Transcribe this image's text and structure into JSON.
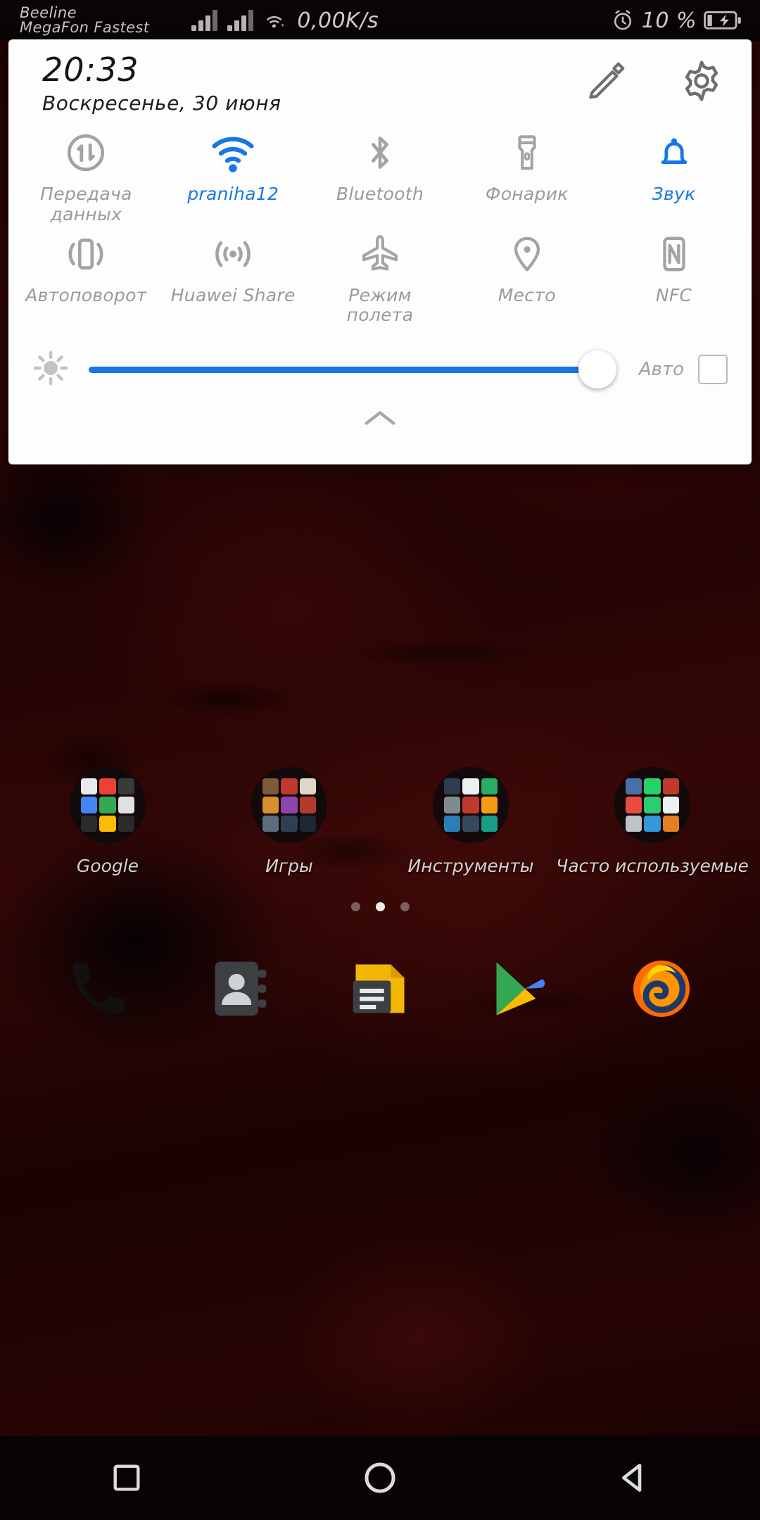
{
  "status_bar": {
    "carrier_line1": "Beeline",
    "carrier_line2": "MegaFon Fastest",
    "data_speed": "0,00K/s",
    "battery_percent": "10 %",
    "icons": [
      "signal-bars-icon",
      "signal-bars-icon",
      "wifi-icon",
      "alarm-clock-icon",
      "battery-charging-icon"
    ]
  },
  "quick_settings": {
    "time": "20:33",
    "date": "Воскресенье, 30 июня",
    "edit_icon": "pencil-icon",
    "settings_icon": "gear-icon",
    "accent_color": "#1678e8",
    "off_color": "#9a9a9a",
    "toggles": [
      {
        "label": "Передача данных",
        "icon": "mobile-data-icon",
        "state": "off"
      },
      {
        "label": "praniha12",
        "icon": "wifi-icon",
        "state": "on"
      },
      {
        "label": "Bluetooth",
        "icon": "bluetooth-icon",
        "state": "off"
      },
      {
        "label": "Фонарик",
        "icon": "flashlight-icon",
        "state": "off"
      },
      {
        "label": "Звук",
        "icon": "bell-icon",
        "state": "on"
      },
      {
        "label": "Автоповорот",
        "icon": "auto-rotate-icon",
        "state": "off"
      },
      {
        "label": "Huawei Share",
        "icon": "huawei-share-icon",
        "state": "off"
      },
      {
        "label": "Режим полета",
        "icon": "airplane-icon",
        "state": "off"
      },
      {
        "label": "Место",
        "icon": "location-pin-icon",
        "state": "off"
      },
      {
        "label": "NFC",
        "icon": "nfc-icon",
        "state": "off"
      }
    ],
    "brightness": {
      "icon": "brightness-sun-icon",
      "value_percent": 100,
      "auto_label": "Авто",
      "auto_checked": false
    },
    "collapse_icon": "chevron-up-icon"
  },
  "home_screen": {
    "folders": [
      {
        "label": "Google"
      },
      {
        "label": "Игры"
      },
      {
        "label": "Инструменты"
      },
      {
        "label": "Часто используемые"
      }
    ],
    "page_dots": {
      "count": 3,
      "active_index": 1
    },
    "dock": [
      {
        "name": "phone-icon"
      },
      {
        "name": "contacts-icon"
      },
      {
        "name": "messages-icon"
      },
      {
        "name": "play-store-icon"
      },
      {
        "name": "firefox-icon"
      }
    ]
  },
  "nav_bar": {
    "recents_label": "recents-square-icon",
    "home_label": "home-circle-icon",
    "back_label": "back-triangle-icon"
  }
}
